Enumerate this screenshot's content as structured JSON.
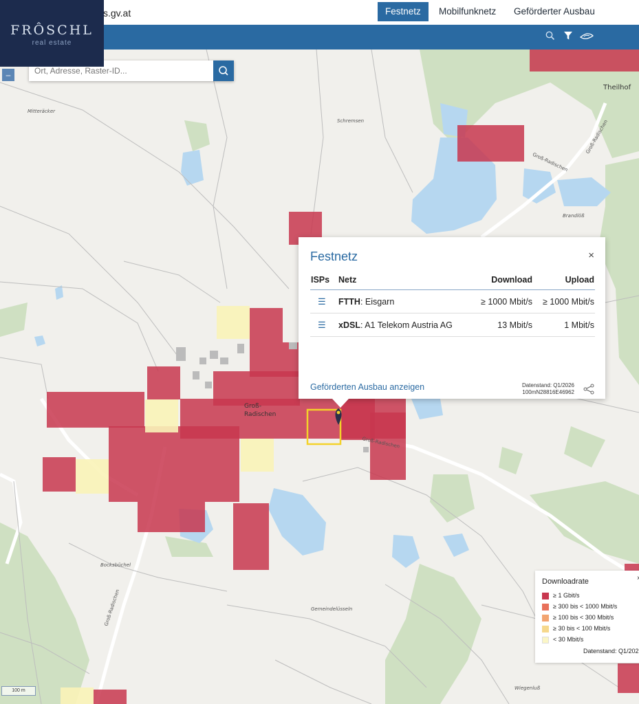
{
  "header": {
    "site_url": "s.gv.at",
    "nav": [
      "Festnetz",
      "Mobilfunknetz",
      "Geförderter Ausbau"
    ],
    "active_nav": "Festnetz",
    "tools": [
      "search-icon",
      "filter-icon",
      "hand-icon"
    ]
  },
  "logo": {
    "name": "FRÔSCHL",
    "sub": "real estate"
  },
  "search": {
    "placeholder": "Ort, Adresse, Raster-ID..."
  },
  "zoom": {
    "out_label": "–"
  },
  "popup": {
    "title": "Festnetz",
    "close": "×",
    "columns": [
      "ISPs",
      "Netz",
      "Download",
      "Upload"
    ],
    "rows": [
      {
        "tech": "FTTH",
        "provider": ": Eisgarn",
        "download": "≥ 1000 Mbit/s",
        "upload": "≥ 1000 Mbit/s"
      },
      {
        "tech": "xDSL",
        "provider": ": A1 Telekom Austria AG",
        "download": "13 Mbit/s",
        "upload": "1 Mbit/s"
      }
    ],
    "link": "Geförderten Ausbau anzeigen",
    "datenstand": "Datenstand: Q1/2026",
    "cell_id": "100mN28816E46962"
  },
  "legend": {
    "title": "Downloadrate",
    "close": "×",
    "items": [
      {
        "label": "≥ 1 Gbit/s",
        "color": "#c8374f"
      },
      {
        "label": "≥ 300 bis < 1000 Mbit/s",
        "color": "#e8705a"
      },
      {
        "label": "≥ 100 bis < 300 Mbit/s",
        "color": "#f2a470"
      },
      {
        "label": "≥ 30 bis < 100 Mbit/s",
        "color": "#f6d88c"
      },
      {
        "label": "< 30 Mbit/s",
        "color": "#fbf6c6"
      }
    ],
    "footer": "Datenstand: Q1/202"
  },
  "map_labels": {
    "theilhof": "Theilhof",
    "mitteraecker": "Mitteräcker",
    "schremsen": "Schremsen",
    "brandloss": "Brandlöß",
    "gross_radischen": "Groß-\nRadischen",
    "bocksbuechel": "Bocksbüchel",
    "gemeindeluesseln": "Gemeindelüsseln",
    "wiegenluss": "Wiegenluß",
    "road1": "Groß-Radischen",
    "road2": "Groß-Radischen",
    "road3": "Groß-Radischen",
    "road4": "Groß-Radischen"
  },
  "scale": "100 m",
  "colors": {
    "brand_blue": "#2a6aa2",
    "gbit": "#c8374f",
    "low": "#fbf6c6"
  }
}
